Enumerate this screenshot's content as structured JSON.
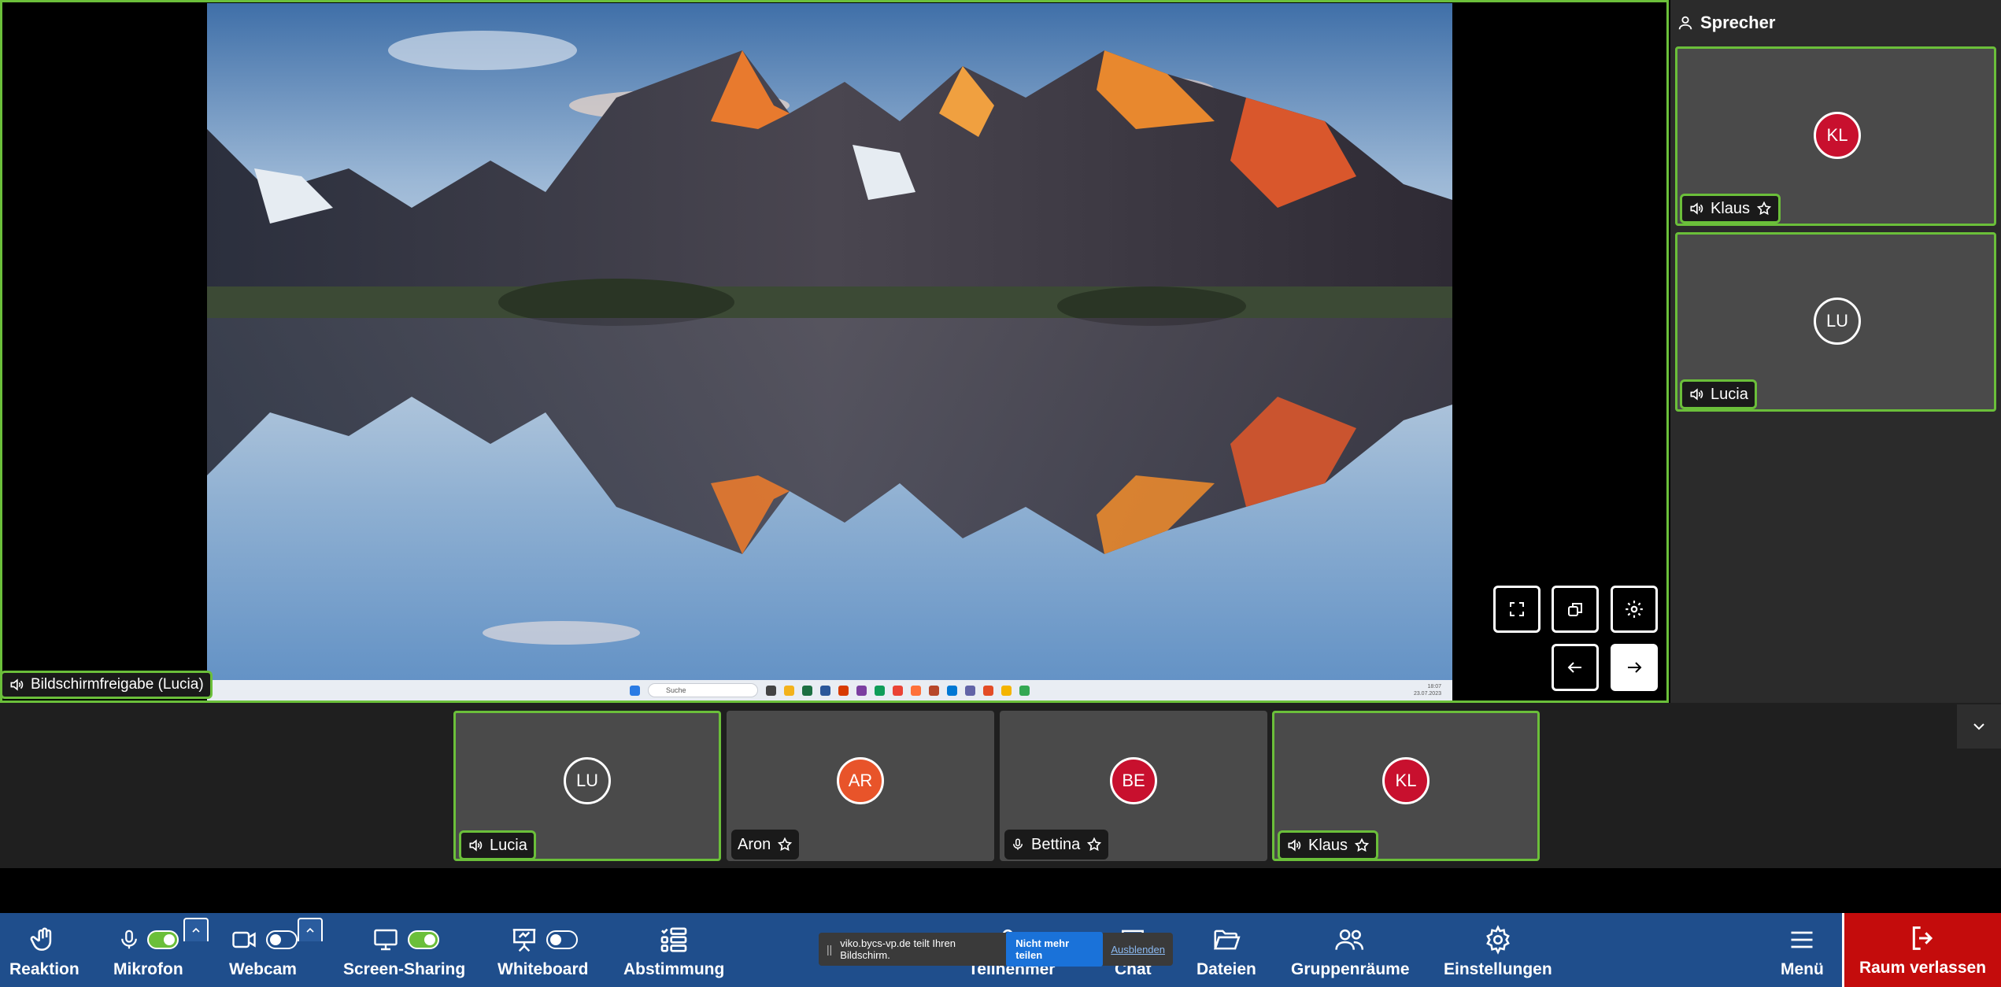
{
  "stage": {
    "share_label": "Bildschirmfreigabe (Lucia)",
    "taskbar_search": "Suche",
    "clock_time": "18:07",
    "clock_date": "23.07.2023"
  },
  "sidebar": {
    "title": "Sprecher",
    "speakers": [
      {
        "initials": "KL",
        "name": "Klaus",
        "color": "#c8102e"
      },
      {
        "initials": "LU",
        "name": "Lucia",
        "color": "#4a4a4a"
      }
    ]
  },
  "participants": [
    {
      "initials": "LU",
      "name": "Lucia",
      "color": "#4a4a4a",
      "active": true
    },
    {
      "initials": "AR",
      "name": "Aron",
      "color": "#e8542a",
      "active": false
    },
    {
      "initials": "BE",
      "name": "Bettina",
      "color": "#c8102e",
      "active": false
    },
    {
      "initials": "KL",
      "name": "Klaus",
      "color": "#c8102e",
      "active": true
    }
  ],
  "toolbar": {
    "reaction": "Reaktion",
    "microphone": "Mikrofon",
    "webcam": "Webcam",
    "screen_sharing": "Screen-Sharing",
    "whiteboard": "Whiteboard",
    "poll": "Abstimmung",
    "participants": "Teilnehmer",
    "chat": "Chat",
    "files": "Dateien",
    "breakout": "Gruppenräume",
    "settings": "Einstellungen",
    "menu": "Menü",
    "leave": "Raum verlassen",
    "microphone_on": true,
    "webcam_on": false,
    "screen_sharing_on": true,
    "whiteboard_on": false
  },
  "notice": {
    "text": "viko.bycs-vp.de teilt Ihren Bildschirm.",
    "stop_button": "Nicht mehr teilen",
    "hide_link": "Ausblenden"
  },
  "colors": {
    "accent_green": "#6bbf3a",
    "toolbar_blue": "#1f4e8c",
    "leave_red": "#c40c0c"
  }
}
